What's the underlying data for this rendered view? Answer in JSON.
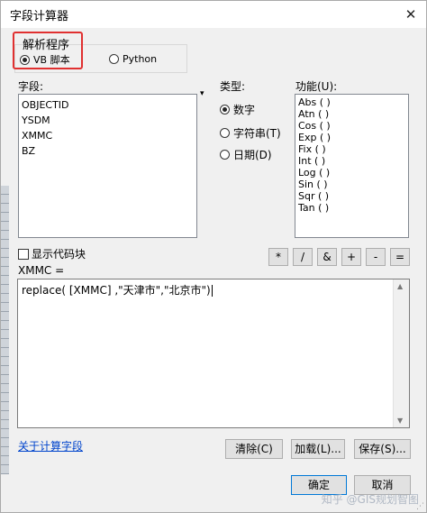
{
  "window": {
    "title": "字段计算器",
    "close_glyph": "✕"
  },
  "parser": {
    "label": "解析程序",
    "options": [
      {
        "label": "VB 脚本",
        "selected": true
      },
      {
        "label": "Python",
        "selected": false
      }
    ]
  },
  "fields": {
    "label": "字段:",
    "items": [
      "OBJECTID",
      "YSDM",
      "XMMC",
      "BZ"
    ]
  },
  "type": {
    "label": "类型:",
    "options": [
      {
        "label": "数字",
        "selected": true
      },
      {
        "label": "字符串(T)",
        "selected": false
      },
      {
        "label": "日期(D)",
        "selected": false
      }
    ]
  },
  "functions": {
    "label": "功能(U):",
    "items": [
      "Abs ( )",
      "Atn ( )",
      "Cos ( )",
      "Exp ( )",
      "Fix ( )",
      "Int ( )",
      "Log ( )",
      "Sin ( )",
      "Sqr ( )",
      "Tan ( )"
    ]
  },
  "show_codeblock": {
    "label": "显示代码块",
    "checked": false
  },
  "operators": [
    "*",
    "/",
    "&",
    "+",
    "-",
    "="
  ],
  "expression": {
    "target_label": "XMMC =",
    "text": "replace( [XMMC] ,\"天津市\",\"北京市\")"
  },
  "help_link": "关于计算字段",
  "buttons": {
    "clear": "清除(C)",
    "load": "加载(L)...",
    "save": "保存(S)...",
    "ok": "确定",
    "cancel": "取消"
  },
  "watermark": "知乎 @GIS规划智图",
  "colors": {
    "highlight_box": "#e03030",
    "link": "#0044cc"
  }
}
